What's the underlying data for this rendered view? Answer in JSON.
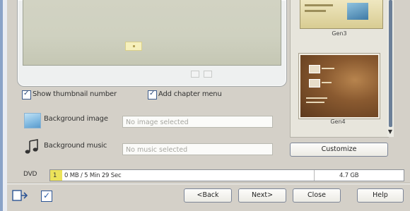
{
  "preview": {
    "show_thumbnail_label": "Show thumbnail number",
    "add_chapter_menu_label": "Add chapter menu"
  },
  "background": {
    "image_label": "Background image",
    "image_placeholder": "No image selected",
    "music_label": "Background music",
    "music_placeholder": "No music selected"
  },
  "thumbnails": {
    "items": [
      {
        "label": "Gen3"
      },
      {
        "label": "Gen4"
      }
    ]
  },
  "buttons": {
    "customize": "Customize",
    "back": "<Back",
    "next": "Next>",
    "close": "Close",
    "help": "Help"
  },
  "disc": {
    "label": "DVD",
    "badge": "1",
    "usage": "0 MB / 5 Min 29 Sec",
    "capacity": "4.7 GB",
    "fill_color": "#ece35a"
  },
  "icons": {
    "image": "picture-icon",
    "music": "music-note-icon",
    "tool1": "export-icon",
    "tool2": "checkbox-icon"
  }
}
